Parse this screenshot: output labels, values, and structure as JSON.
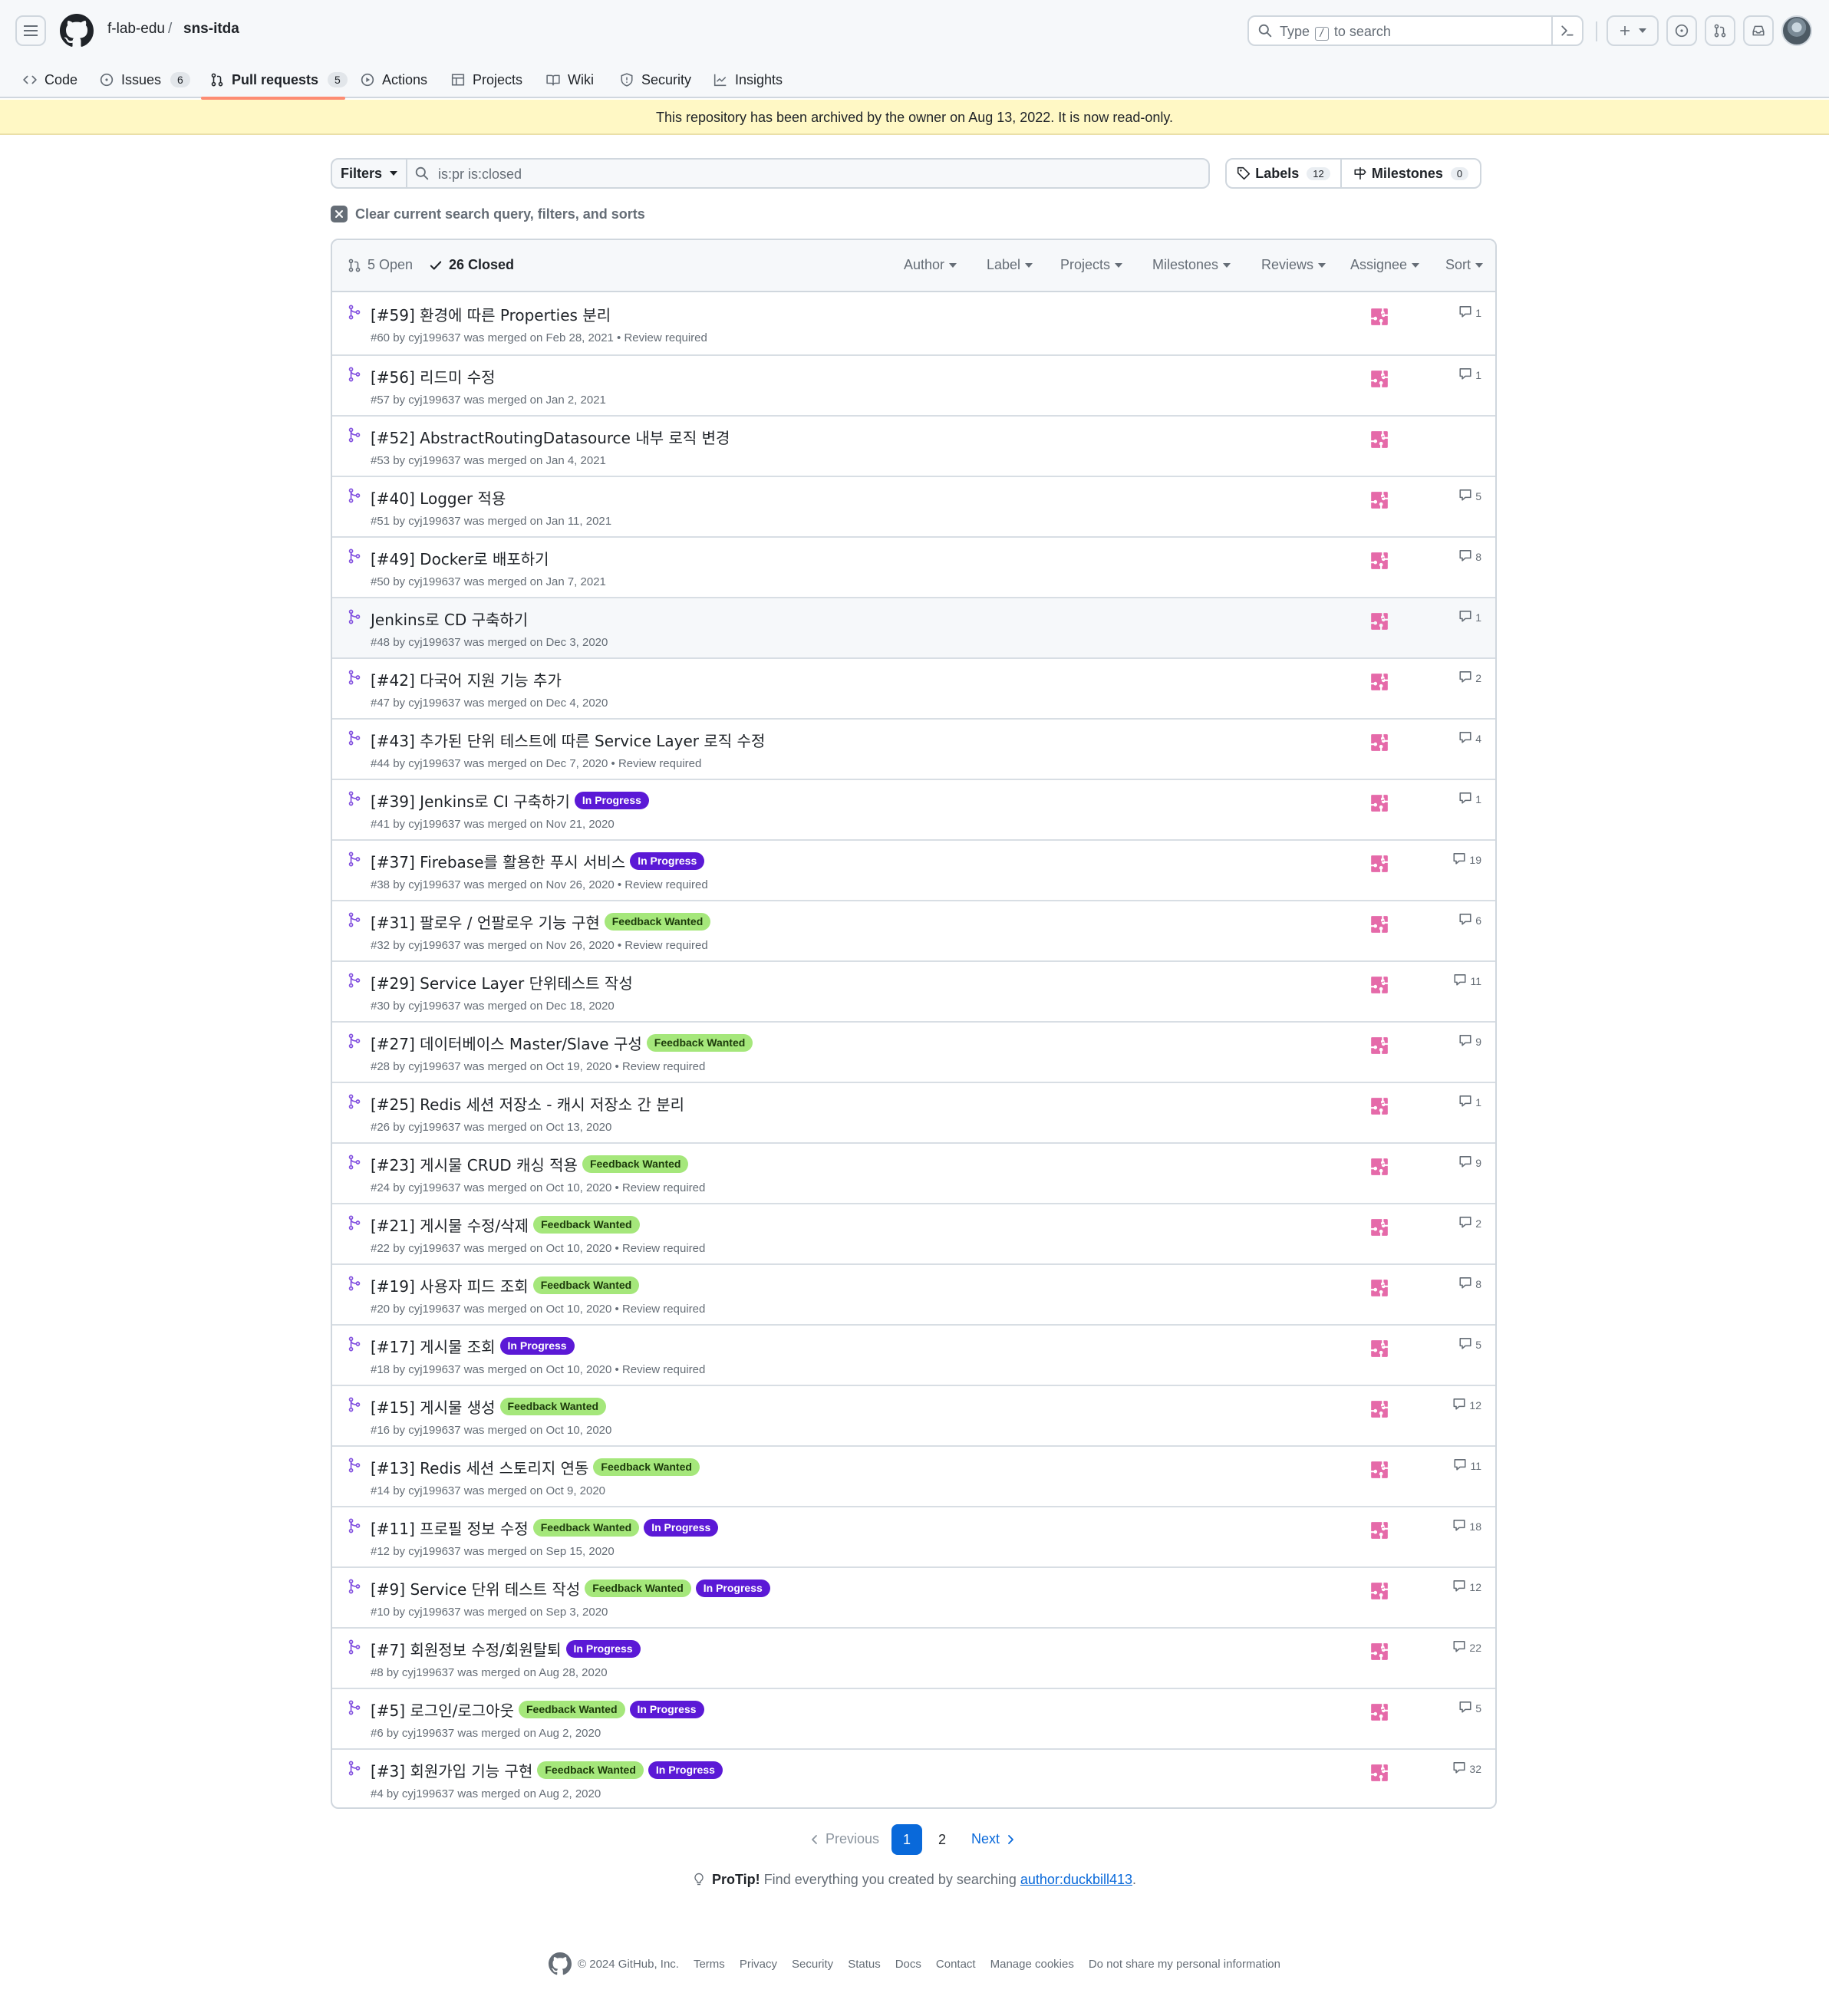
{
  "header": {
    "owner": "f-lab-edu",
    "separator": "/",
    "repo": "sns-itda",
    "search_before": "Type",
    "search_key": "/",
    "search_after": "to search"
  },
  "tabs": [
    {
      "label": "Code",
      "icon": "code-icon"
    },
    {
      "label": "Issues",
      "count": "6",
      "icon": "issue-icon"
    },
    {
      "label": "Pull requests",
      "count": "5",
      "icon": "pull-request-icon"
    },
    {
      "label": "Actions",
      "icon": "play-icon"
    },
    {
      "label": "Projects",
      "icon": "table-icon"
    },
    {
      "label": "Wiki",
      "icon": "book-icon"
    },
    {
      "label": "Security",
      "icon": "shield-icon"
    },
    {
      "label": "Insights",
      "icon": "graph-icon"
    }
  ],
  "banner": "This repository has been archived by the owner on Aug 13, 2022. It is now read-only.",
  "filters": {
    "filters_label": "Filters",
    "query_value": "is:pr is:closed",
    "labels_label": "Labels",
    "labels_count": "12",
    "milestones_label": "Milestones",
    "milestones_count": "0",
    "clear_text": "Clear current search query, filters, and sorts"
  },
  "list_header": {
    "open": "5 Open",
    "closed": "26 Closed",
    "author": "Author",
    "label": "Label",
    "projects": "Projects",
    "milestones": "Milestones",
    "reviews": "Reviews",
    "assignee": "Assignee",
    "sort": "Sort"
  },
  "label_colors": {
    "feedback_wanted": "#a5e77b",
    "in_progress": "#5b19d6"
  },
  "pull_requests": [
    {
      "title": "[#59] 환경에 따른 Properties 분리",
      "labels": [],
      "meta": "#60 by cyj199637 was merged on Feb 28, 2021 • Review required",
      "comments": "1"
    },
    {
      "title": "[#56] 리드미 수정",
      "labels": [],
      "meta": "#57 by cyj199637 was merged on Jan 2, 2021",
      "comments": "1"
    },
    {
      "title": "[#52] AbstractRoutingDatasource 내부 로직 변경",
      "labels": [],
      "meta": "#53 by cyj199637 was merged on Jan 4, 2021",
      "comments": ""
    },
    {
      "title": "[#40] Logger 적용",
      "labels": [],
      "meta": "#51 by cyj199637 was merged on Jan 11, 2021",
      "comments": "5"
    },
    {
      "title": "[#49] Docker로 배포하기",
      "labels": [],
      "meta": "#50 by cyj199637 was merged on Jan 7, 2021",
      "comments": "8"
    },
    {
      "title": "Jenkins로 CD 구축하기",
      "labels": [],
      "meta": "#48 by cyj199637 was merged on Dec 3, 2020",
      "comments": "1"
    },
    {
      "title": "[#42] 다국어 지원 기능 추가",
      "labels": [],
      "meta": "#47 by cyj199637 was merged on Dec 4, 2020",
      "comments": "2"
    },
    {
      "title": "[#43] 추가된 단위 테스트에 따른 Service Layer 로직 수정",
      "labels": [],
      "meta": "#44 by cyj199637 was merged on Dec 7, 2020 • Review required",
      "comments": "4"
    },
    {
      "title": "[#39] Jenkins로 CI 구축하기",
      "labels": [
        "In Progress"
      ],
      "meta": "#41 by cyj199637 was merged on Nov 21, 2020",
      "comments": "1"
    },
    {
      "title": "[#37] Firebase를 활용한 푸시 서비스",
      "labels": [
        "In Progress"
      ],
      "meta": "#38 by cyj199637 was merged on Nov 26, 2020 • Review required",
      "comments": "19"
    },
    {
      "title": "[#31] 팔로우 / 언팔로우 기능 구현",
      "labels": [
        "Feedback Wanted"
      ],
      "meta": "#32 by cyj199637 was merged on Nov 26, 2020 • Review required",
      "comments": "6"
    },
    {
      "title": "[#29] Service Layer 단위테스트 작성",
      "labels": [],
      "meta": "#30 by cyj199637 was merged on Dec 18, 2020",
      "comments": "11"
    },
    {
      "title": "[#27] 데이터베이스 Master/Slave 구성",
      "labels": [
        "Feedback Wanted"
      ],
      "meta": "#28 by cyj199637 was merged on Oct 19, 2020 • Review required",
      "comments": "9"
    },
    {
      "title": "[#25] Redis 세션 저장소 - 캐시 저장소 간 분리",
      "labels": [],
      "meta": "#26 by cyj199637 was merged on Oct 13, 2020",
      "comments": "1"
    },
    {
      "title": "[#23] 게시물 CRUD 캐싱 적용",
      "labels": [
        "Feedback Wanted"
      ],
      "meta": "#24 by cyj199637 was merged on Oct 10, 2020 • Review required",
      "comments": "9"
    },
    {
      "title": "[#21] 게시물 수정/삭제",
      "labels": [
        "Feedback Wanted"
      ],
      "meta": "#22 by cyj199637 was merged on Oct 10, 2020 • Review required",
      "comments": "2"
    },
    {
      "title": "[#19] 사용자 피드 조회",
      "labels": [
        "Feedback Wanted"
      ],
      "meta": "#20 by cyj199637 was merged on Oct 10, 2020 • Review required",
      "comments": "8"
    },
    {
      "title": "[#17] 게시물 조회",
      "labels": [
        "In Progress"
      ],
      "meta": "#18 by cyj199637 was merged on Oct 10, 2020 • Review required",
      "comments": "5"
    },
    {
      "title": "[#15] 게시물 생성",
      "labels": [
        "Feedback Wanted"
      ],
      "meta": "#16 by cyj199637 was merged on Oct 10, 2020",
      "comments": "12"
    },
    {
      "title": "[#13] Redis 세션 스토리지 연동",
      "labels": [
        "Feedback Wanted"
      ],
      "meta": "#14 by cyj199637 was merged on Oct 9, 2020",
      "comments": "11"
    },
    {
      "title": "[#11] 프로필 정보 수정",
      "labels": [
        "Feedback Wanted",
        "In Progress"
      ],
      "meta": "#12 by cyj199637 was merged on Sep 15, 2020",
      "comments": "18"
    },
    {
      "title": "[#9] Service 단위 테스트 작성",
      "labels": [
        "Feedback Wanted",
        "In Progress"
      ],
      "meta": "#10 by cyj199637 was merged on Sep 3, 2020",
      "comments": "12"
    },
    {
      "title": "[#7] 회원정보 수정/회원탈퇴",
      "labels": [
        "In Progress"
      ],
      "meta": "#8 by cyj199637 was merged on Aug 28, 2020",
      "comments": "22"
    },
    {
      "title": "[#5] 로그인/로그아웃",
      "labels": [
        "Feedback Wanted",
        "In Progress"
      ],
      "meta": "#6 by cyj199637 was merged on Aug 2, 2020",
      "comments": "5"
    },
    {
      "title": "[#3] 회원가입 기능 구현",
      "labels": [
        "Feedback Wanted",
        "In Progress"
      ],
      "meta": "#4 by cyj199637 was merged on Aug 2, 2020",
      "comments": "32"
    }
  ],
  "pagination": {
    "previous": "Previous",
    "current": "1",
    "page2": "2",
    "next": "Next"
  },
  "protip": {
    "bold": "ProTip!",
    "text": "Find everything you created by searching",
    "link": "author:duckbill413",
    "end": "."
  },
  "footer": {
    "copyright": "© 2024 GitHub, Inc.",
    "links": [
      "Terms",
      "Privacy",
      "Security",
      "Status",
      "Docs",
      "Contact",
      "Manage cookies",
      "Do not share my personal information"
    ]
  }
}
